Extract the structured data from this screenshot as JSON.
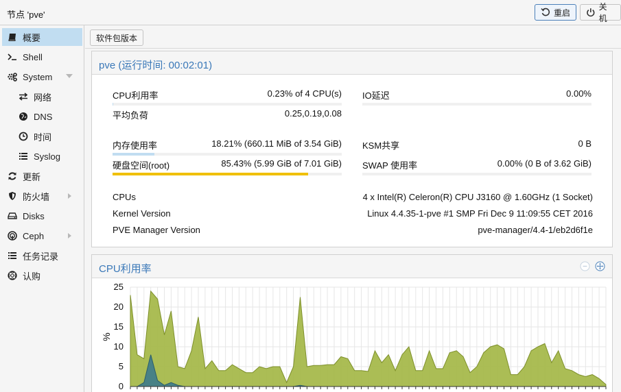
{
  "header": {
    "title": "节点 'pve'",
    "reboot_label": "重启",
    "shutdown_label": "关机"
  },
  "sidebar": {
    "items": [
      {
        "label": "概要",
        "icon": "book-icon",
        "selected": true
      },
      {
        "label": "Shell",
        "icon": "terminal-icon"
      },
      {
        "label": "System",
        "icon": "cogs-icon",
        "expandable": "down"
      },
      {
        "label": "网络",
        "icon": "exchange-icon",
        "sub": true
      },
      {
        "label": "DNS",
        "icon": "globe-icon",
        "sub": true
      },
      {
        "label": "时间",
        "icon": "clock-icon",
        "sub": true
      },
      {
        "label": "Syslog",
        "icon": "list-icon",
        "sub": true
      },
      {
        "label": "更新",
        "icon": "refresh-icon"
      },
      {
        "label": "防火墙",
        "icon": "shield-icon",
        "expandable": "right"
      },
      {
        "label": "Disks",
        "icon": "hdd-icon"
      },
      {
        "label": "Ceph",
        "icon": "ceph-icon",
        "expandable": "right"
      },
      {
        "label": "任务记录",
        "icon": "list-icon"
      },
      {
        "label": "认购",
        "icon": "support-icon"
      }
    ]
  },
  "toolbar": {
    "package_versions_label": "软件包版本"
  },
  "status": {
    "title": "pve (运行时间: 00:02:01)",
    "cpu_label": "CPU利用率",
    "cpu_value": "0.23% of 4 CPU(s)",
    "cpu_fraction": 0.0023,
    "load_label": "平均负荷",
    "load_value": "0.25,0.19,0.08",
    "io_label": "IO延迟",
    "io_value": "0.00%",
    "io_fraction": 0,
    "mem_label": "内存使用率",
    "mem_value": "18.21% (660.11 MiB of 3.54 GiB)",
    "mem_fraction": 0.1821,
    "ksm_label": "KSM共享",
    "ksm_value": "0 B",
    "disk_label": "硬盘空间(root)",
    "disk_value": "85.43% (5.99 GiB of 7.01 GiB)",
    "disk_fraction": 0.8543,
    "swap_label": "SWAP 使用率",
    "swap_value": "0.00% (0 B of 3.62 GiB)",
    "swap_fraction": 0,
    "cpus_label": "CPUs",
    "cpus_value": "4 x Intel(R) Celeron(R) CPU J3160 @ 1.60GHz (1 Socket)",
    "kernel_label": "Kernel Version",
    "kernel_value": "Linux 4.4.35-1-pve #1 SMP Fri Dec 9 11:09:55 CET 2016",
    "pve_label": "PVE Manager Version",
    "pve_value": "pve-manager/4.4-1/eb2d6f1e"
  },
  "colors": {
    "accent": "#3a78b8",
    "disk_bar": "#f0c000",
    "mem_bar": "#c1ddf1",
    "cpu_area": "#a7b94c",
    "cpu_line": "#7d8f2a",
    "io_area": "#3d7a8c",
    "selected": "#c1ddf1"
  },
  "chart_data": {
    "type": "area",
    "title": "CPU利用率",
    "ylabel": "%",
    "ylim": [
      0,
      25
    ],
    "yticks": [
      0,
      5,
      10,
      15,
      20,
      25
    ],
    "grid": true,
    "series": [
      {
        "values": [
          23,
          8,
          7,
          24,
          22,
          13,
          19,
          5,
          4.5,
          9,
          17.5,
          4.5,
          6.5,
          4,
          4,
          5.5,
          4.5,
          3.5,
          3.5,
          5,
          4.5,
          5,
          5,
          1,
          5,
          22.5,
          5,
          5.3,
          5.3,
          5.5,
          5.5,
          7.5,
          7,
          4,
          4,
          3.8,
          9,
          6,
          8,
          4,
          8,
          10,
          4,
          4,
          9,
          4.5,
          4.5,
          8.5,
          9,
          7.5,
          3.5,
          5,
          8.5,
          10,
          10.5,
          9.5,
          3,
          3,
          5,
          9,
          10,
          10.8,
          6,
          9,
          4.5,
          4,
          3,
          2.5,
          3,
          2,
          0.5
        ]
      },
      {
        "values": [
          0,
          0,
          1,
          8,
          1.5,
          0.3,
          1,
          0.3,
          0,
          0,
          0,
          0,
          0,
          0,
          0,
          0,
          0,
          0,
          0,
          0,
          0,
          0,
          0,
          0,
          0,
          0.3,
          0,
          0,
          0,
          0,
          0,
          0,
          0,
          0,
          0,
          0,
          0,
          0,
          0,
          0,
          0,
          0,
          0,
          0,
          0,
          0,
          0,
          0,
          0,
          0,
          0,
          0,
          0,
          0,
          0,
          0,
          0,
          0,
          0,
          0,
          0,
          0,
          0,
          0,
          0,
          0,
          0,
          0,
          0,
          0,
          0
        ]
      }
    ]
  }
}
